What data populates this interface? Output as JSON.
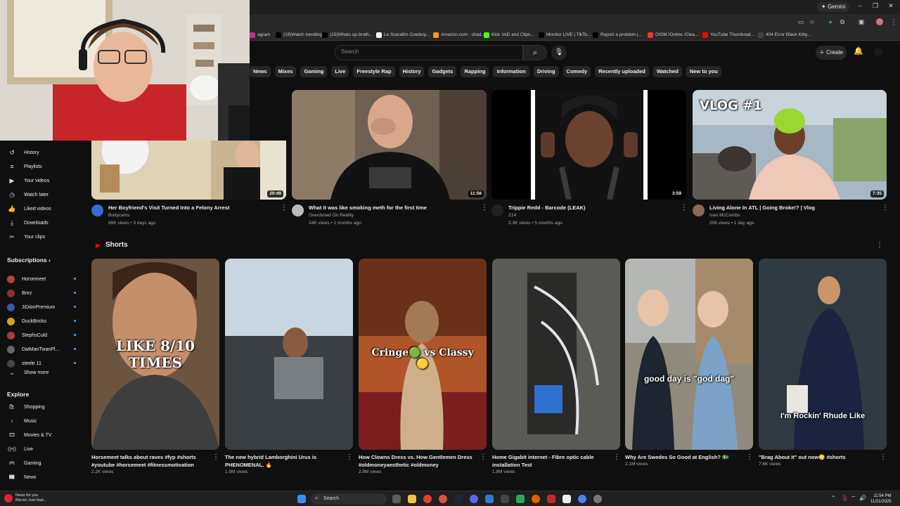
{
  "browser": {
    "gemini_label": "Gemini",
    "window_controls": [
      "–",
      "❐",
      "✕"
    ]
  },
  "bookmarks": [
    {
      "label": "agram",
      "color": "#c13584"
    },
    {
      "label": "(19)Watch trending...",
      "color": "#000000"
    },
    {
      "label": "(15)Whats up broth...",
      "color": "#000000"
    },
    {
      "label": "Le Sserafim Cowboy...",
      "color": "#ffffff"
    },
    {
      "label": "Amazon.com : shad...",
      "color": "#ff9900"
    },
    {
      "label": "Kick VoD and Clips...",
      "color": "#53fc18"
    },
    {
      "label": "Monitor LIVE | TikTo...",
      "color": "#000000"
    },
    {
      "label": "Report a problem |...",
      "color": "#000000"
    },
    {
      "label": "OISM /Online /Clea...",
      "color": "#e53935"
    },
    {
      "label": "YouTube Thumbnail...",
      "color": "#ff0000"
    },
    {
      "label": "404 Error Black Kitty...",
      "color": "#444444"
    }
  ],
  "header": {
    "search_placeholder": "Search",
    "create_label": "Create"
  },
  "chips": [
    "News",
    "Mixes",
    "Gaming",
    "Live",
    "Freestyle Rap",
    "History",
    "Gadgets",
    "Rapping",
    "Information",
    "Driving",
    "Comedy",
    "Recently uploaded",
    "Watched",
    "New to you"
  ],
  "sidebar": {
    "you_items": [
      {
        "label": "History",
        "icon": "history-icon",
        "glyph": "↺"
      },
      {
        "label": "Playlists",
        "icon": "playlists-icon",
        "glyph": "≡"
      },
      {
        "label": "Your videos",
        "icon": "your-videos-icon",
        "glyph": "▶"
      },
      {
        "label": "Watch later",
        "icon": "watch-later-icon",
        "glyph": "◷"
      },
      {
        "label": "Liked videos",
        "icon": "thumbs-up-icon",
        "glyph": "👍"
      },
      {
        "label": "Downloads",
        "icon": "download-icon",
        "glyph": "⤓"
      },
      {
        "label": "Your clips",
        "icon": "scissors-icon",
        "glyph": "✂"
      }
    ],
    "subscriptions_title": "Subscriptions",
    "subscriptions": [
      {
        "label": "Horsemeet",
        "color": "#b0473a"
      },
      {
        "label": "Brez",
        "color": "#8a2f2f"
      },
      {
        "label": "JiDionPremium",
        "color": "#3a58b0"
      },
      {
        "label": "DuckBricks",
        "color": "#d9a21b"
      },
      {
        "label": "StephsCold",
        "color": "#b03a3a"
      },
      {
        "label": "DatManTwanPl...",
        "color": "#666666"
      },
      {
        "label": "steele 11",
        "color": "#444444"
      }
    ],
    "show_more": "Show more",
    "explore_title": "Explore",
    "explore": [
      {
        "label": "Shopping",
        "icon": "shopping-bag-icon",
        "glyph": "🛍"
      },
      {
        "label": "Music",
        "icon": "music-icon",
        "glyph": "♪"
      },
      {
        "label": "Movies & TV",
        "icon": "movies-icon",
        "glyph": "🎞"
      },
      {
        "label": "Live",
        "icon": "live-icon",
        "glyph": "((•))"
      },
      {
        "label": "Gaming",
        "icon": "gaming-icon",
        "glyph": "🎮"
      },
      {
        "label": "News",
        "icon": "news-icon",
        "glyph": "📰"
      }
    ]
  },
  "videos": [
    {
      "title": "Her Boyfriend's Visit Turned Into a Felony Arrest",
      "channel": "Bodycams",
      "meta": "86K views • 3 days ago",
      "duration": "20:49",
      "av_color": "#3a6bd6",
      "thumb_bg": "#e8dcc0"
    },
    {
      "title": "What it was like smoking meth for the first time",
      "channel": "Overdosed On Reality",
      "meta": "24K views • 2 months ago",
      "duration": "11:56",
      "av_color": "#bbbbbb",
      "thumb_bg": "#5a4c40"
    },
    {
      "title": "Trippie Redd - Barcode (LEAK)",
      "channel": "Z14",
      "meta": "2.3K views • 5 months ago",
      "duration": "3:59",
      "av_color": "#222222",
      "thumb_bg": "#000000"
    },
    {
      "title": "Living Alone In ATL | Going Broke!? | Vlog",
      "channel": "Ivan McCombs",
      "meta": "206 views • 1 day ago",
      "duration": "7:35",
      "av_color": "#8a6a55",
      "thumb_bg": "#9fb4c8",
      "caption": "VLOG #1"
    }
  ],
  "shorts_title": "Shorts",
  "shorts": [
    {
      "title": "Horsemeet talks about raves #fyp #shorts #youtube #horsemeet #fitnessmotivation",
      "views": "2.2K views",
      "caption": "LIKE 8/10 TIMES",
      "bg": "#6b5440"
    },
    {
      "title": "The new hybrid Lamborghini Urus is PHENOMENAL. 🔥",
      "views": "1.9M views",
      "caption": "",
      "bg": "#8e979c"
    },
    {
      "title": "How Clowns Dress vs. How Gentlemen Dress #oldmoneyaesthetic #oldmoney",
      "views": "2.8M views",
      "caption": "Cringe🟢 vs Classy🟡",
      "bg": "#b0552a"
    },
    {
      "title": "Home Gigabit internet - Fibre optic cable installation Test",
      "views": "1.8M views",
      "caption": "",
      "bg": "#6a6a66"
    },
    {
      "title": "Why Are Swedes So Good at English? 🇸🇪",
      "views": "2.1M views",
      "caption": "good day is \"god dag\"",
      "bg": "#8f8a7c"
    },
    {
      "title": "\"Brag About it\" out now😳 #shorts",
      "views": "7.6K views",
      "caption": "I'm Rockin' Rhude Like",
      "bg": "#3c4750"
    }
  ],
  "taskbar": {
    "news_line1": "News for you",
    "news_line2": "Bitcoin Just Had...",
    "search_label": "Search",
    "time": "11:54 PM",
    "date": "11/21/2025"
  }
}
